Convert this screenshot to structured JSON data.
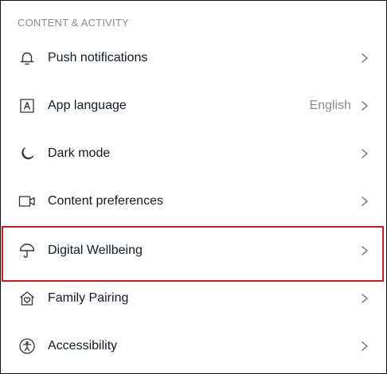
{
  "section": {
    "title": "CONTENT & ACTIVITY"
  },
  "rows": [
    {
      "label": "Push notifications",
      "icon": "bell-icon"
    },
    {
      "label": "App language",
      "value": "English",
      "icon": "language-icon"
    },
    {
      "label": "Dark mode",
      "icon": "moon-icon"
    },
    {
      "label": "Content preferences",
      "icon": "video-camera-icon"
    },
    {
      "label": "Digital Wellbeing",
      "icon": "umbrella-icon",
      "highlighted": true
    },
    {
      "label": "Family Pairing",
      "icon": "family-house-icon"
    },
    {
      "label": "Accessibility",
      "icon": "accessibility-icon"
    }
  ],
  "colors": {
    "text": "#161823",
    "muted": "#8a8b91",
    "highlight": "#e0141e"
  }
}
